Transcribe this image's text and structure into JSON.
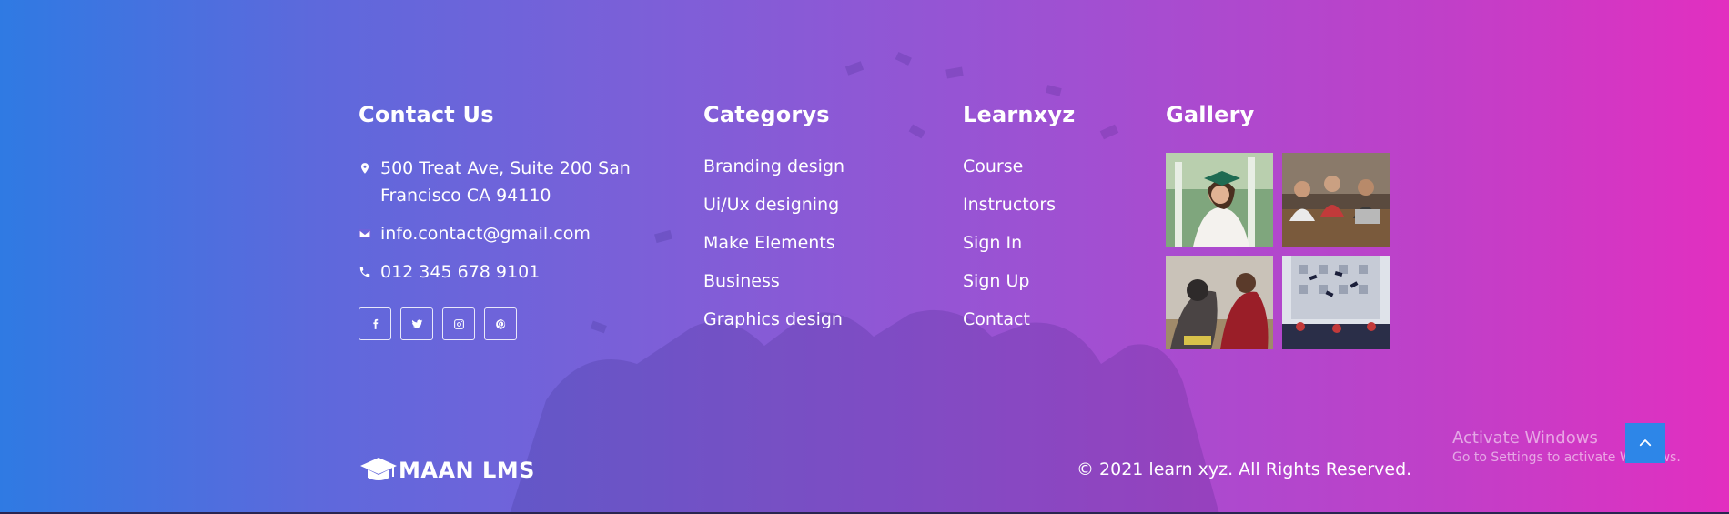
{
  "contact": {
    "title": "Contact Us",
    "address": "500 Treat Ave, Suite 200 San Francisco CA 94110",
    "email": "info.contact@gmail.com",
    "phone": "012 345 678 9101",
    "social": [
      "facebook-icon",
      "twitter-icon",
      "instagram-icon",
      "pinterest-icon"
    ]
  },
  "categories": {
    "title": "Categorys",
    "items": [
      "Branding design",
      "Ui/Ux designing",
      "Make Elements",
      "Business",
      "Graphics design"
    ]
  },
  "learn": {
    "title": "Learnxyz",
    "items": [
      "Course",
      "Instructors",
      "Sign In",
      "Sign Up",
      "Contact"
    ]
  },
  "gallery": {
    "title": "Gallery"
  },
  "footer": {
    "logo_text": "MAAN LMS",
    "copyright": "© 2021 learn xyz. All Rights Reserved."
  },
  "watermark": {
    "title": "Activate Windows",
    "subtitle": "Go to Settings to activate Windows."
  },
  "colors": {
    "gradient_start": "#2f7ae3",
    "gradient_end": "#e22fc0",
    "scroll_button": "#2d86e8"
  }
}
